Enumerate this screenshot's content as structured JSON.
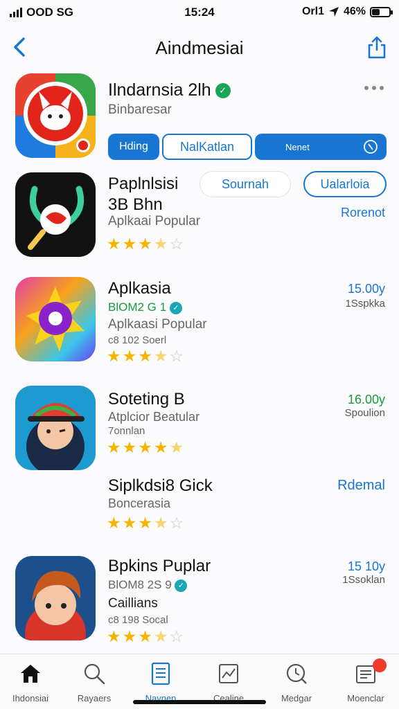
{
  "status": {
    "carrier": "OOD SG",
    "time": "15:24",
    "network": "Orl1",
    "battery": "46%",
    "battery_level": 0.46
  },
  "nav": {
    "title": "Aindmesiai"
  },
  "featured": {
    "name": "Ilndarnsia 2lh",
    "subtitle": "Binbaresar",
    "buttons": [
      "Hding",
      "NalKatlan",
      "Nenet"
    ]
  },
  "apps": [
    {
      "name": "Paplnlsisi",
      "name2": "3B Bhn",
      "subtitle": "Aplkaai Popular",
      "rating": 3.5,
      "pill1": "Sournah",
      "pill2": "Ualarloia",
      "right": "Rorenot"
    },
    {
      "name": "Aplkasia",
      "meta_green": "BlOM2 G 1",
      "subtitle": "Aplkaasi Popular",
      "meta": "c8 102 Soerl",
      "rating": 3.5,
      "right": "15.00y",
      "right2": "1Sspkka"
    },
    {
      "name": "Soteting B",
      "subtitle": "Atplcior Beatular",
      "meta": "7onnlan",
      "rating": 4.5,
      "right": "16.00y",
      "right2": "Spoulion"
    },
    {
      "name": "Siplkdsi8 Gick",
      "subtitle": "Boncerasia",
      "rating": 3.5,
      "right": "Rdemal"
    },
    {
      "name": "Bpkins Puplar",
      "meta_grey": "BlOM8 2S 9",
      "subtitle": "Caillians",
      "meta": "c8 198 Socal",
      "rating": 3.5,
      "right": "15 10y",
      "right2": "1Ssoklan"
    }
  ],
  "tabs": [
    {
      "label": "Ihdonsiai",
      "icon": "home-icon"
    },
    {
      "label": "Rayaers",
      "icon": "search-icon"
    },
    {
      "label": "Navnen",
      "icon": "document-icon"
    },
    {
      "label": "Cealine",
      "icon": "chart-icon"
    },
    {
      "label": "Medgar",
      "icon": "clock-search-icon"
    },
    {
      "label": "Moenclar",
      "icon": "news-icon"
    }
  ],
  "colors": {
    "accent": "#1876d2",
    "star": "#f4b400",
    "green": "#169a3a",
    "badge_red": "#f03a2b"
  }
}
